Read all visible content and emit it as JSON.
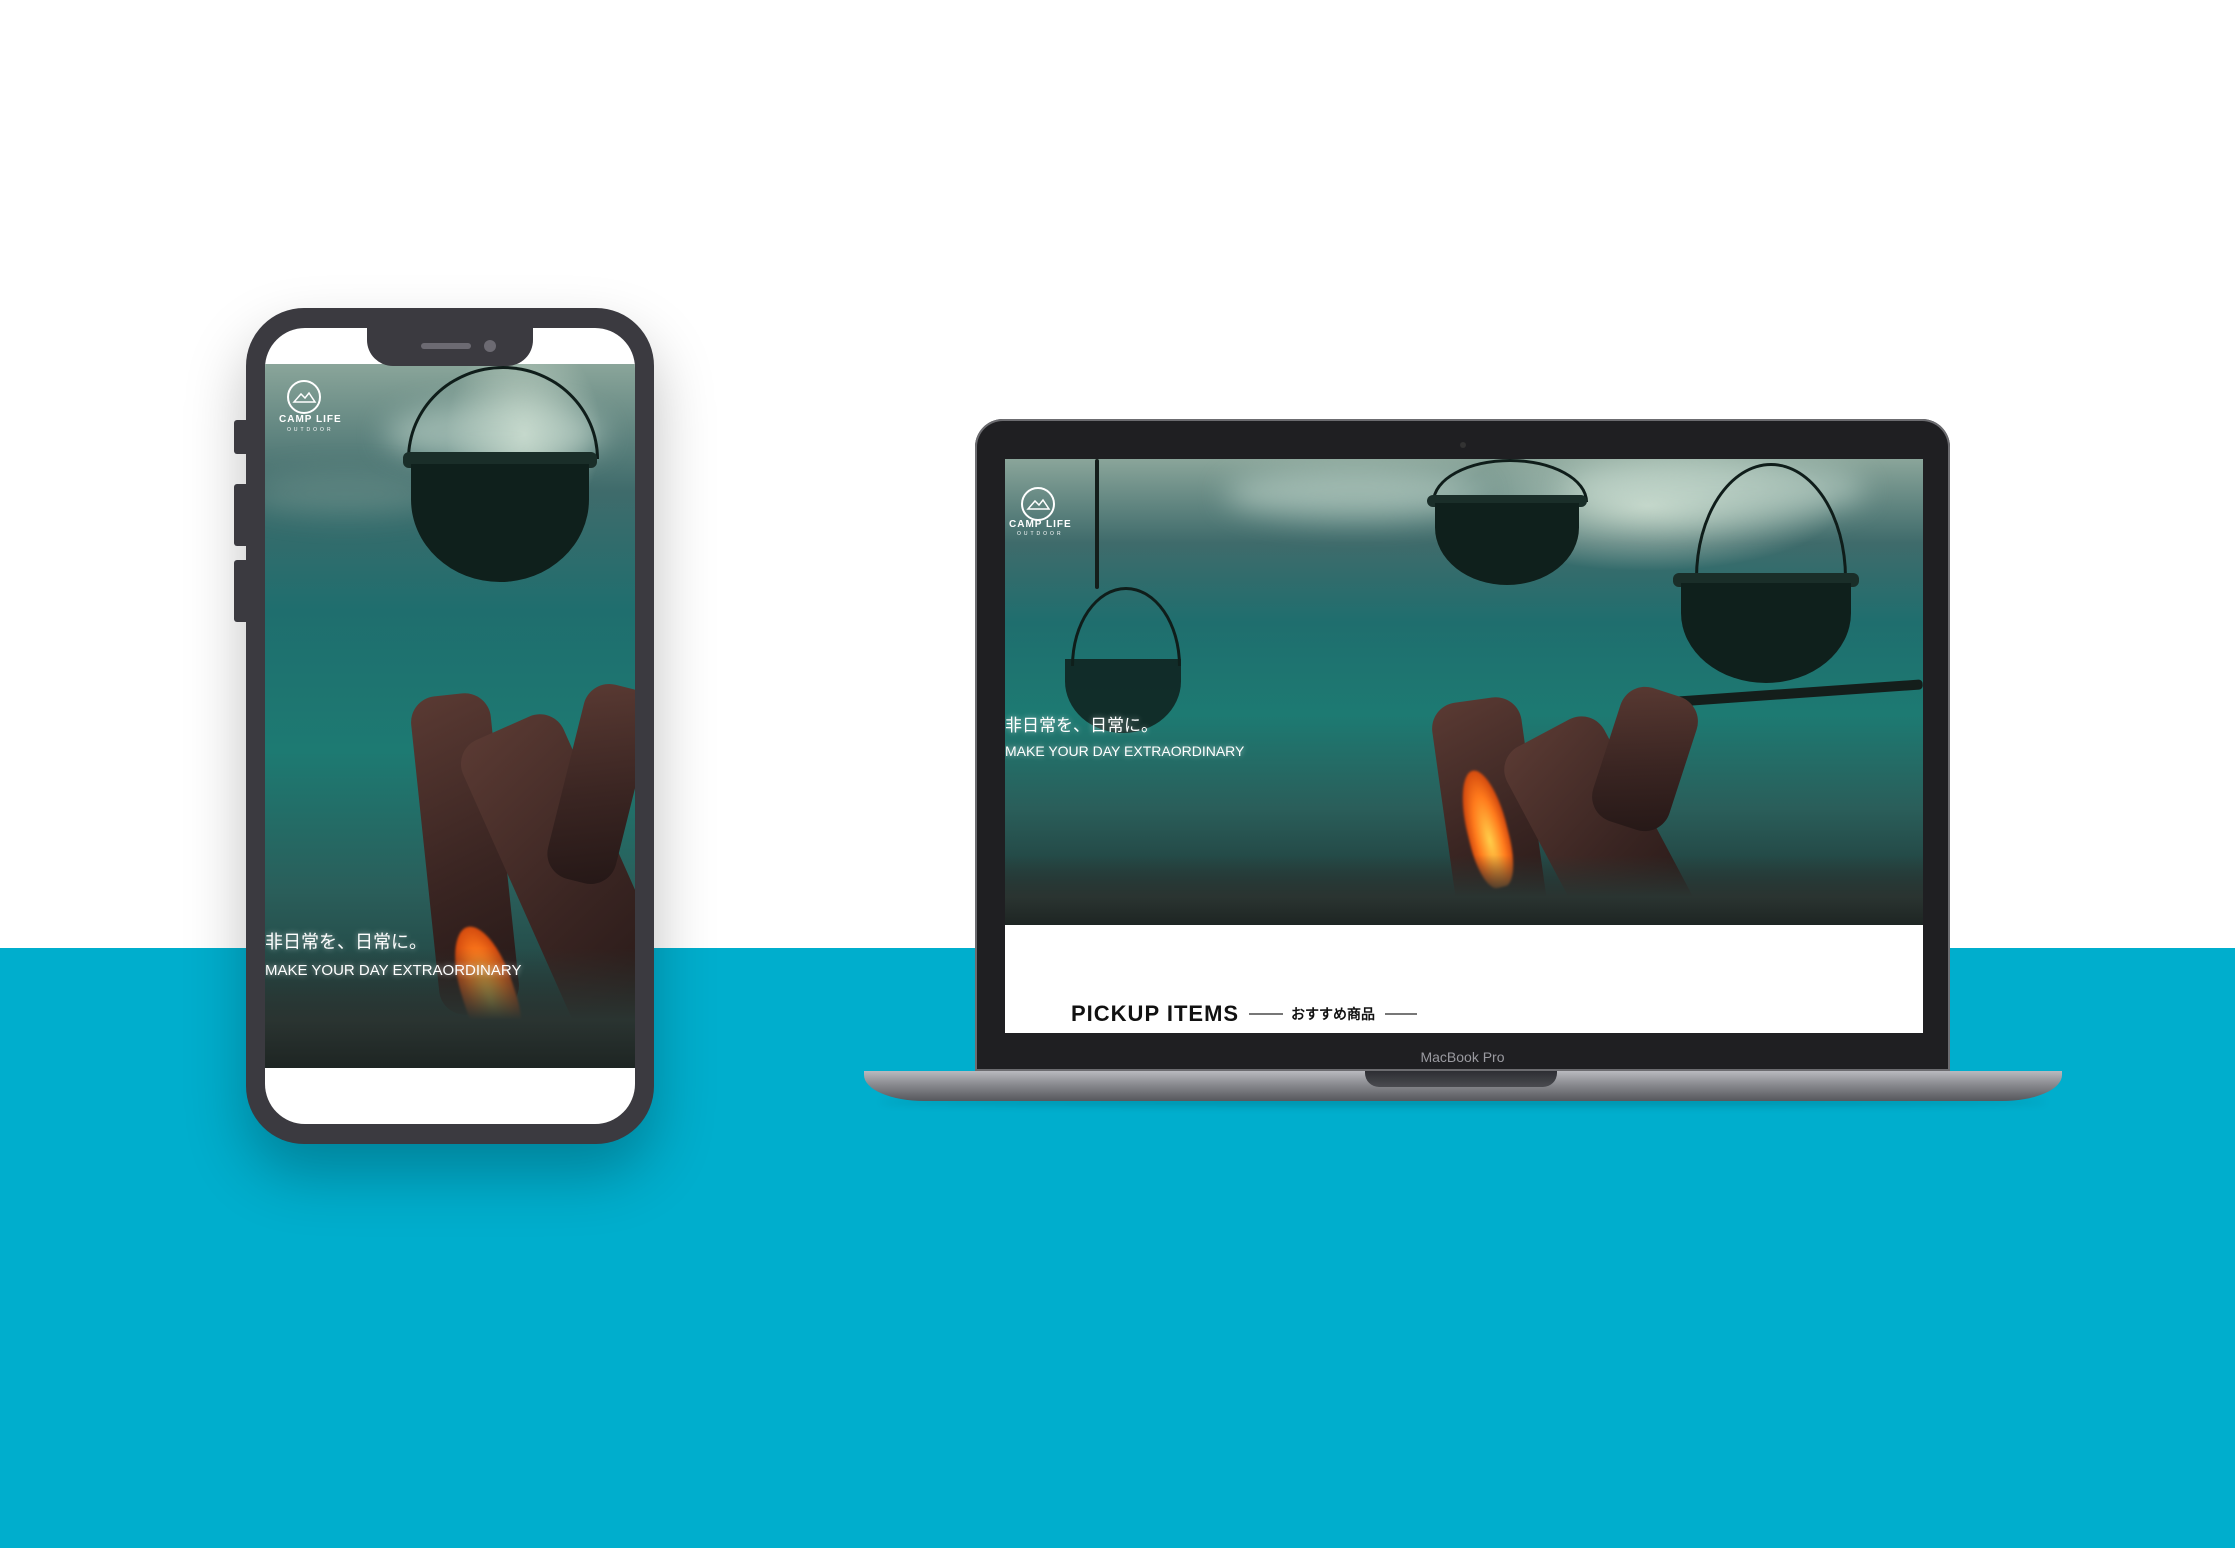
{
  "brand": {
    "name": "CAMP LIFE",
    "sub": "OUTDOOR"
  },
  "hero": {
    "tagline_jp": "非日常を、日常に。",
    "tagline_en": "MAKE YOUR DAY EXTRAORDINARY"
  },
  "section": {
    "title": "PICKUP ITEMS",
    "subtitle": "おすすめ商品"
  },
  "device": {
    "laptop_label": "MacBook Pro"
  },
  "colors": {
    "accent": "#00aecd",
    "device_frame": "#3b3a40"
  }
}
